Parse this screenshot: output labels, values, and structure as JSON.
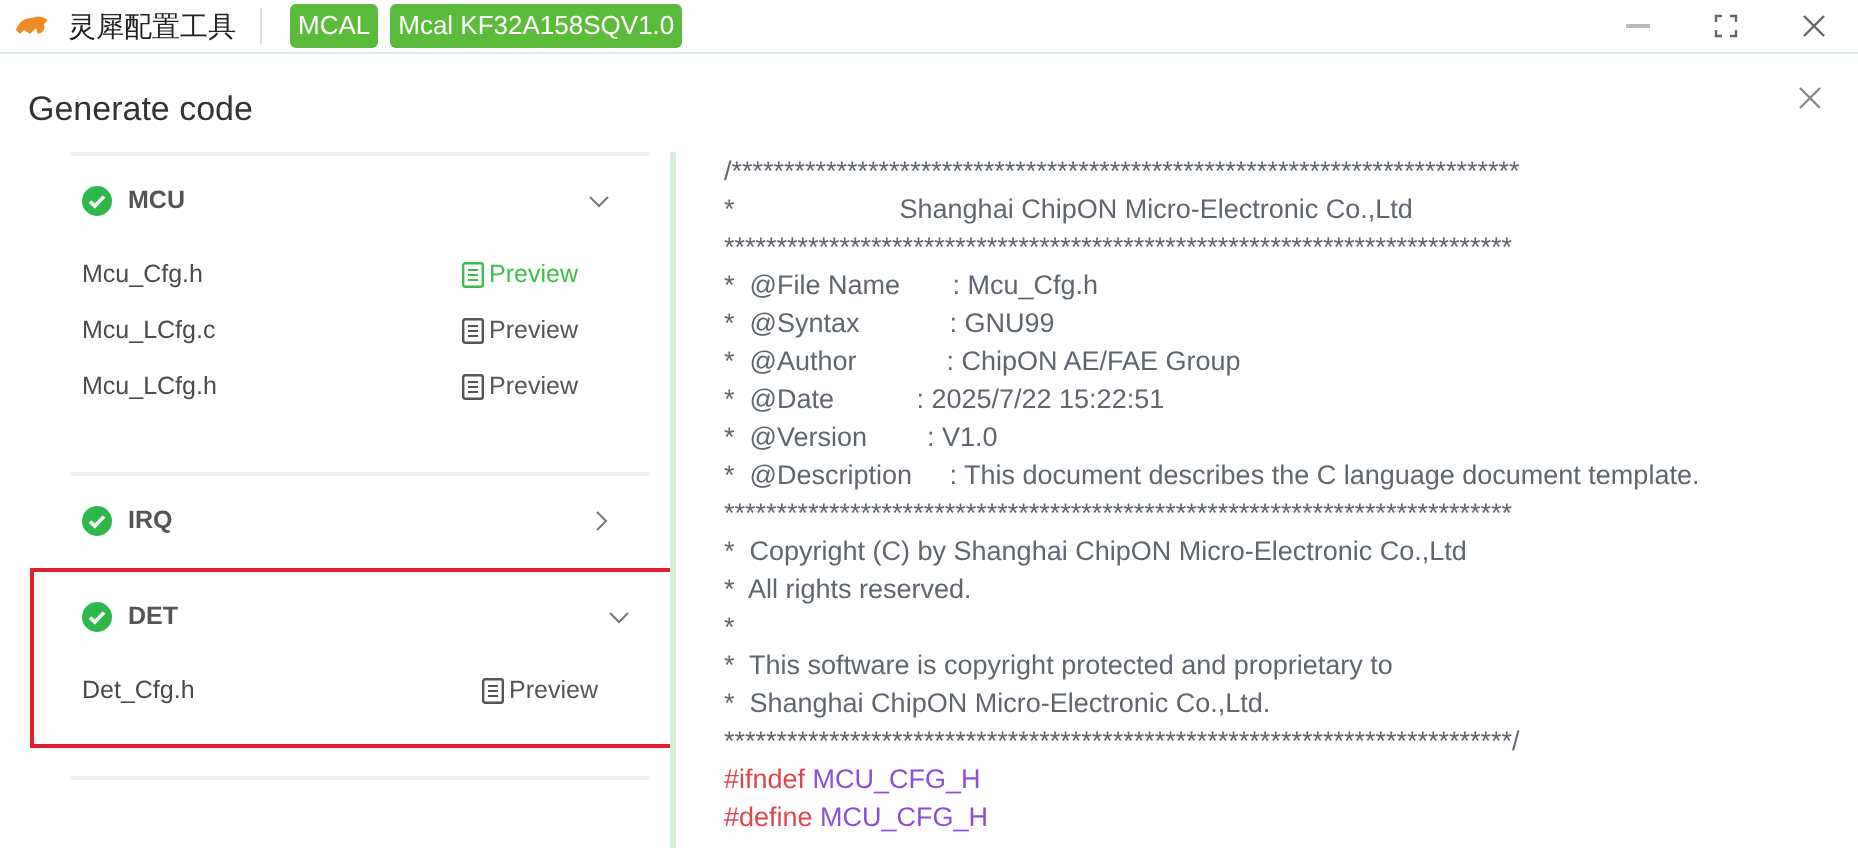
{
  "app": {
    "title": "灵犀配置工具",
    "tags": [
      "MCAL",
      "Mcal KF32A158SQV1.0"
    ]
  },
  "dialog": {
    "title": "Generate code",
    "modules": [
      {
        "name": "MCU",
        "done": true,
        "expanded": true,
        "highlighted": false,
        "files": [
          {
            "name": "Mcu_Cfg.h",
            "action": "Preview",
            "selected": true
          },
          {
            "name": "Mcu_LCfg.c",
            "action": "Preview",
            "selected": false
          },
          {
            "name": "Mcu_LCfg.h",
            "action": "Preview",
            "selected": false
          }
        ]
      },
      {
        "name": "IRQ",
        "done": true,
        "expanded": false,
        "highlighted": false
      },
      {
        "name": "DET",
        "done": true,
        "expanded": true,
        "highlighted": true,
        "files": [
          {
            "name": "Det_Cfg.h",
            "action": "Preview",
            "selected": false
          }
        ]
      }
    ],
    "code": [
      [
        {
          "kind": "comment",
          "text": "/***************************************************************************"
        }
      ],
      [
        {
          "kind": "comment",
          "text": "*                      Shanghai ChipON Micro-Electronic Co.,Ltd"
        }
      ],
      [
        {
          "kind": "comment",
          "text": "***************************************************************************"
        }
      ],
      [
        {
          "kind": "comment",
          "text": "*  @File Name       : Mcu_Cfg.h"
        }
      ],
      [
        {
          "kind": "comment",
          "text": "*  @Syntax            : GNU99"
        }
      ],
      [
        {
          "kind": "comment",
          "text": "*  @Author            : ChipON AE/FAE Group"
        }
      ],
      [
        {
          "kind": "comment",
          "text": "*  @Date           : 2025/7/22 15:22:51"
        }
      ],
      [
        {
          "kind": "comment",
          "text": "*  @Version        : V1.0"
        }
      ],
      [
        {
          "kind": "comment",
          "text": "*  @Description     : This document describes the C language document template."
        }
      ],
      [
        {
          "kind": "comment",
          "text": "***************************************************************************"
        }
      ],
      [
        {
          "kind": "comment",
          "text": "*  Copyright (C) by Shanghai ChipON Micro-Electronic Co.,Ltd"
        }
      ],
      [
        {
          "kind": "comment",
          "text": "*  All rights reserved."
        }
      ],
      [
        {
          "kind": "comment",
          "text": "*"
        }
      ],
      [
        {
          "kind": "comment",
          "text": "*  This software is copyright protected and proprietary to"
        }
      ],
      [
        {
          "kind": "comment",
          "text": "*  Shanghai ChipON Micro-Electronic Co.,Ltd."
        }
      ],
      [
        {
          "kind": "comment",
          "text": "***************************************************************************/"
        }
      ],
      [
        {
          "kind": "directive",
          "text": "#ifndef"
        },
        {
          "kind": "macro",
          "text": "MCU_CFG_H"
        }
      ],
      [
        {
          "kind": "directive",
          "text": "#define"
        },
        {
          "kind": "macro",
          "text": "MCU_CFG_H"
        }
      ]
    ]
  }
}
